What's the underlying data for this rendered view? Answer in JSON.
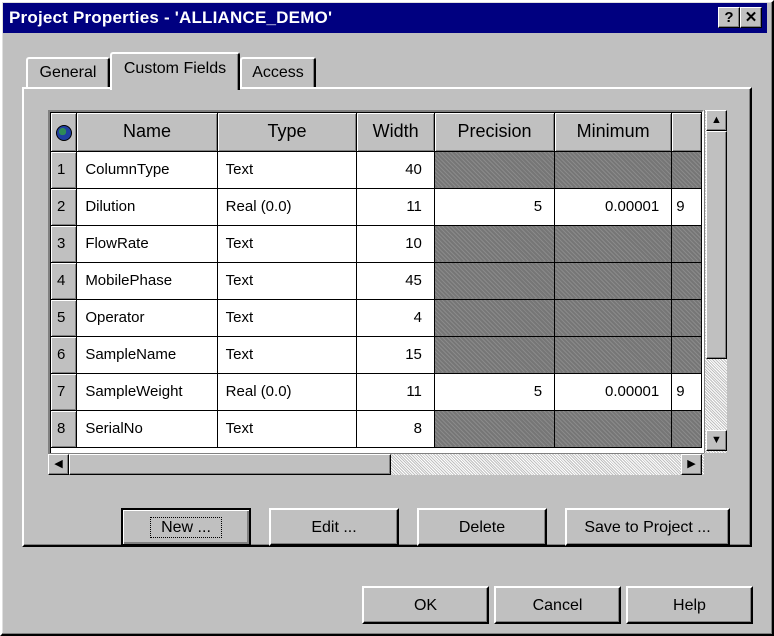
{
  "window": {
    "title": "Project Properties - 'ALLIANCE_DEMO'",
    "help_button": "?",
    "close_button": "✕"
  },
  "tabs": [
    {
      "label": "General"
    },
    {
      "label": "Custom Fields"
    },
    {
      "label": "Access"
    }
  ],
  "grid": {
    "columns": [
      "Name",
      "Type",
      "Width",
      "Precision",
      "Minimum"
    ],
    "rows": [
      {
        "num": "1",
        "name": "ColumnType",
        "type": "Text",
        "width": "40",
        "precision": "",
        "minimum": "",
        "extra": ""
      },
      {
        "num": "2",
        "name": "Dilution",
        "type": "Real (0.0)",
        "width": "11",
        "precision": "5",
        "minimum": "0.00001",
        "extra": "9"
      },
      {
        "num": "3",
        "name": "FlowRate",
        "type": "Text",
        "width": "10",
        "precision": "",
        "minimum": "",
        "extra": ""
      },
      {
        "num": "4",
        "name": "MobilePhase",
        "type": "Text",
        "width": "45",
        "precision": "",
        "minimum": "",
        "extra": ""
      },
      {
        "num": "5",
        "name": "Operator",
        "type": "Text",
        "width": "4",
        "precision": "",
        "minimum": "",
        "extra": ""
      },
      {
        "num": "6",
        "name": "SampleName",
        "type": "Text",
        "width": "15",
        "precision": "",
        "minimum": "",
        "extra": ""
      },
      {
        "num": "7",
        "name": "SampleWeight",
        "type": "Real (0.0)",
        "width": "11",
        "precision": "5",
        "minimum": "0.00001",
        "extra": "9"
      },
      {
        "num": "8",
        "name": "SerialNo",
        "type": "Text",
        "width": "8",
        "precision": "",
        "minimum": "",
        "extra": ""
      }
    ]
  },
  "actions": {
    "new": "New ...",
    "edit": "Edit ...",
    "delete": "Delete",
    "save": "Save to Project ..."
  },
  "footer": {
    "ok": "OK",
    "cancel": "Cancel",
    "help": "Help"
  },
  "icons": {
    "scroll_up": "▲",
    "scroll_down": "▼",
    "scroll_left": "◀",
    "scroll_right": "▶"
  }
}
